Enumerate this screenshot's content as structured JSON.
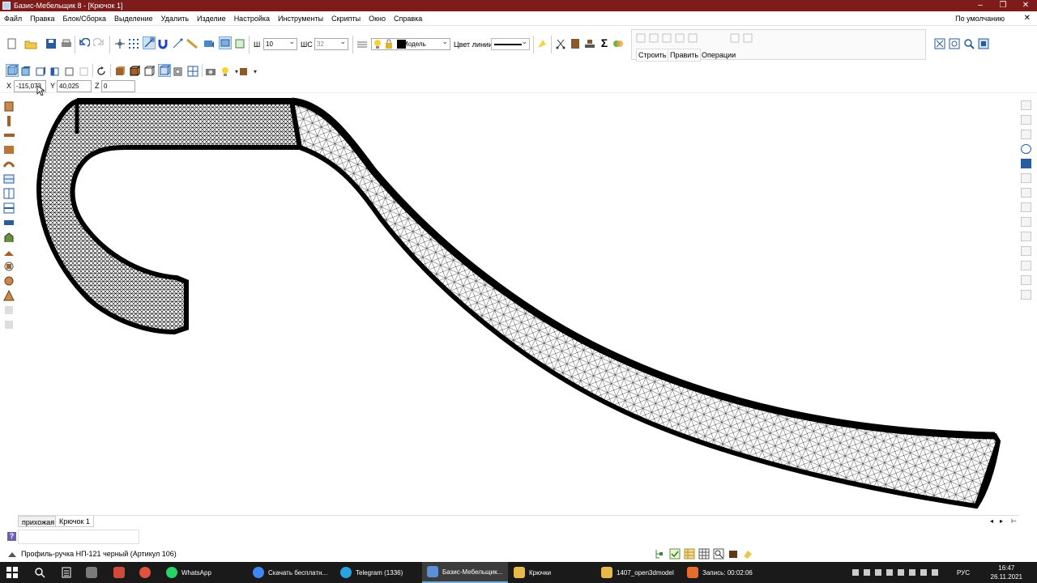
{
  "window": {
    "title": "Базис-Мебельщик 8 - [Крючок 1]",
    "controls": [
      "–",
      "❐",
      "✕"
    ]
  },
  "menu": {
    "items": [
      "Файл",
      "Правка",
      "Блок/Сборка",
      "Выделение",
      "Удалить",
      "Изделие",
      "Настройка",
      "Инструменты",
      "Скрипты",
      "Окно",
      "Справка"
    ],
    "preset": "По умолчанию",
    "close": "✕"
  },
  "toolbar": {
    "width_label": "Ш",
    "width_value": "10",
    "height_label": "ШС",
    "height_value": "32",
    "layer_value": "Модель",
    "line_color_label": "Цвет линии",
    "ops_tabs": [
      "Строить",
      "Править"
    ],
    "ops_label": "Операции",
    "sum_icon": "Σ"
  },
  "coords": {
    "x_label": "X",
    "x_value": "-115,073",
    "y_label": "Y",
    "y_value": "40,025",
    "z_label": "Z",
    "z_value": "0"
  },
  "tabs": [
    "прихожая",
    "Крючок 1"
  ],
  "tab_nav": [
    "◂",
    "▸",
    "⊢"
  ],
  "status": {
    "help_icon": "?",
    "object_text": "Профиль-ручка НП-121 черный (Артикул 106)"
  },
  "taskbar": {
    "apps": [
      {
        "label": "WhatsApp",
        "color": "#25d366"
      },
      {
        "label": "Скачать бесплатн...",
        "color": "#4285f4"
      },
      {
        "label": "Telegram (1336)",
        "color": "#2aa3e0"
      },
      {
        "label": "Базис-Мебельщик...",
        "color": "#5b8fd6"
      },
      {
        "label": "Крючки",
        "color": "#e8b84b"
      },
      {
        "label": "1407_open3dmodel",
        "color": "#e8b84b"
      },
      {
        "label": "Запись: 00:02:06",
        "color": "#e56b2f"
      }
    ],
    "lang": "РУС",
    "time": "16:47",
    "date": "26.11.2021"
  },
  "colors": {
    "titlebar": "#7d1c1a",
    "accent_blue": "#2a5b9c",
    "mesh": "#000000"
  }
}
